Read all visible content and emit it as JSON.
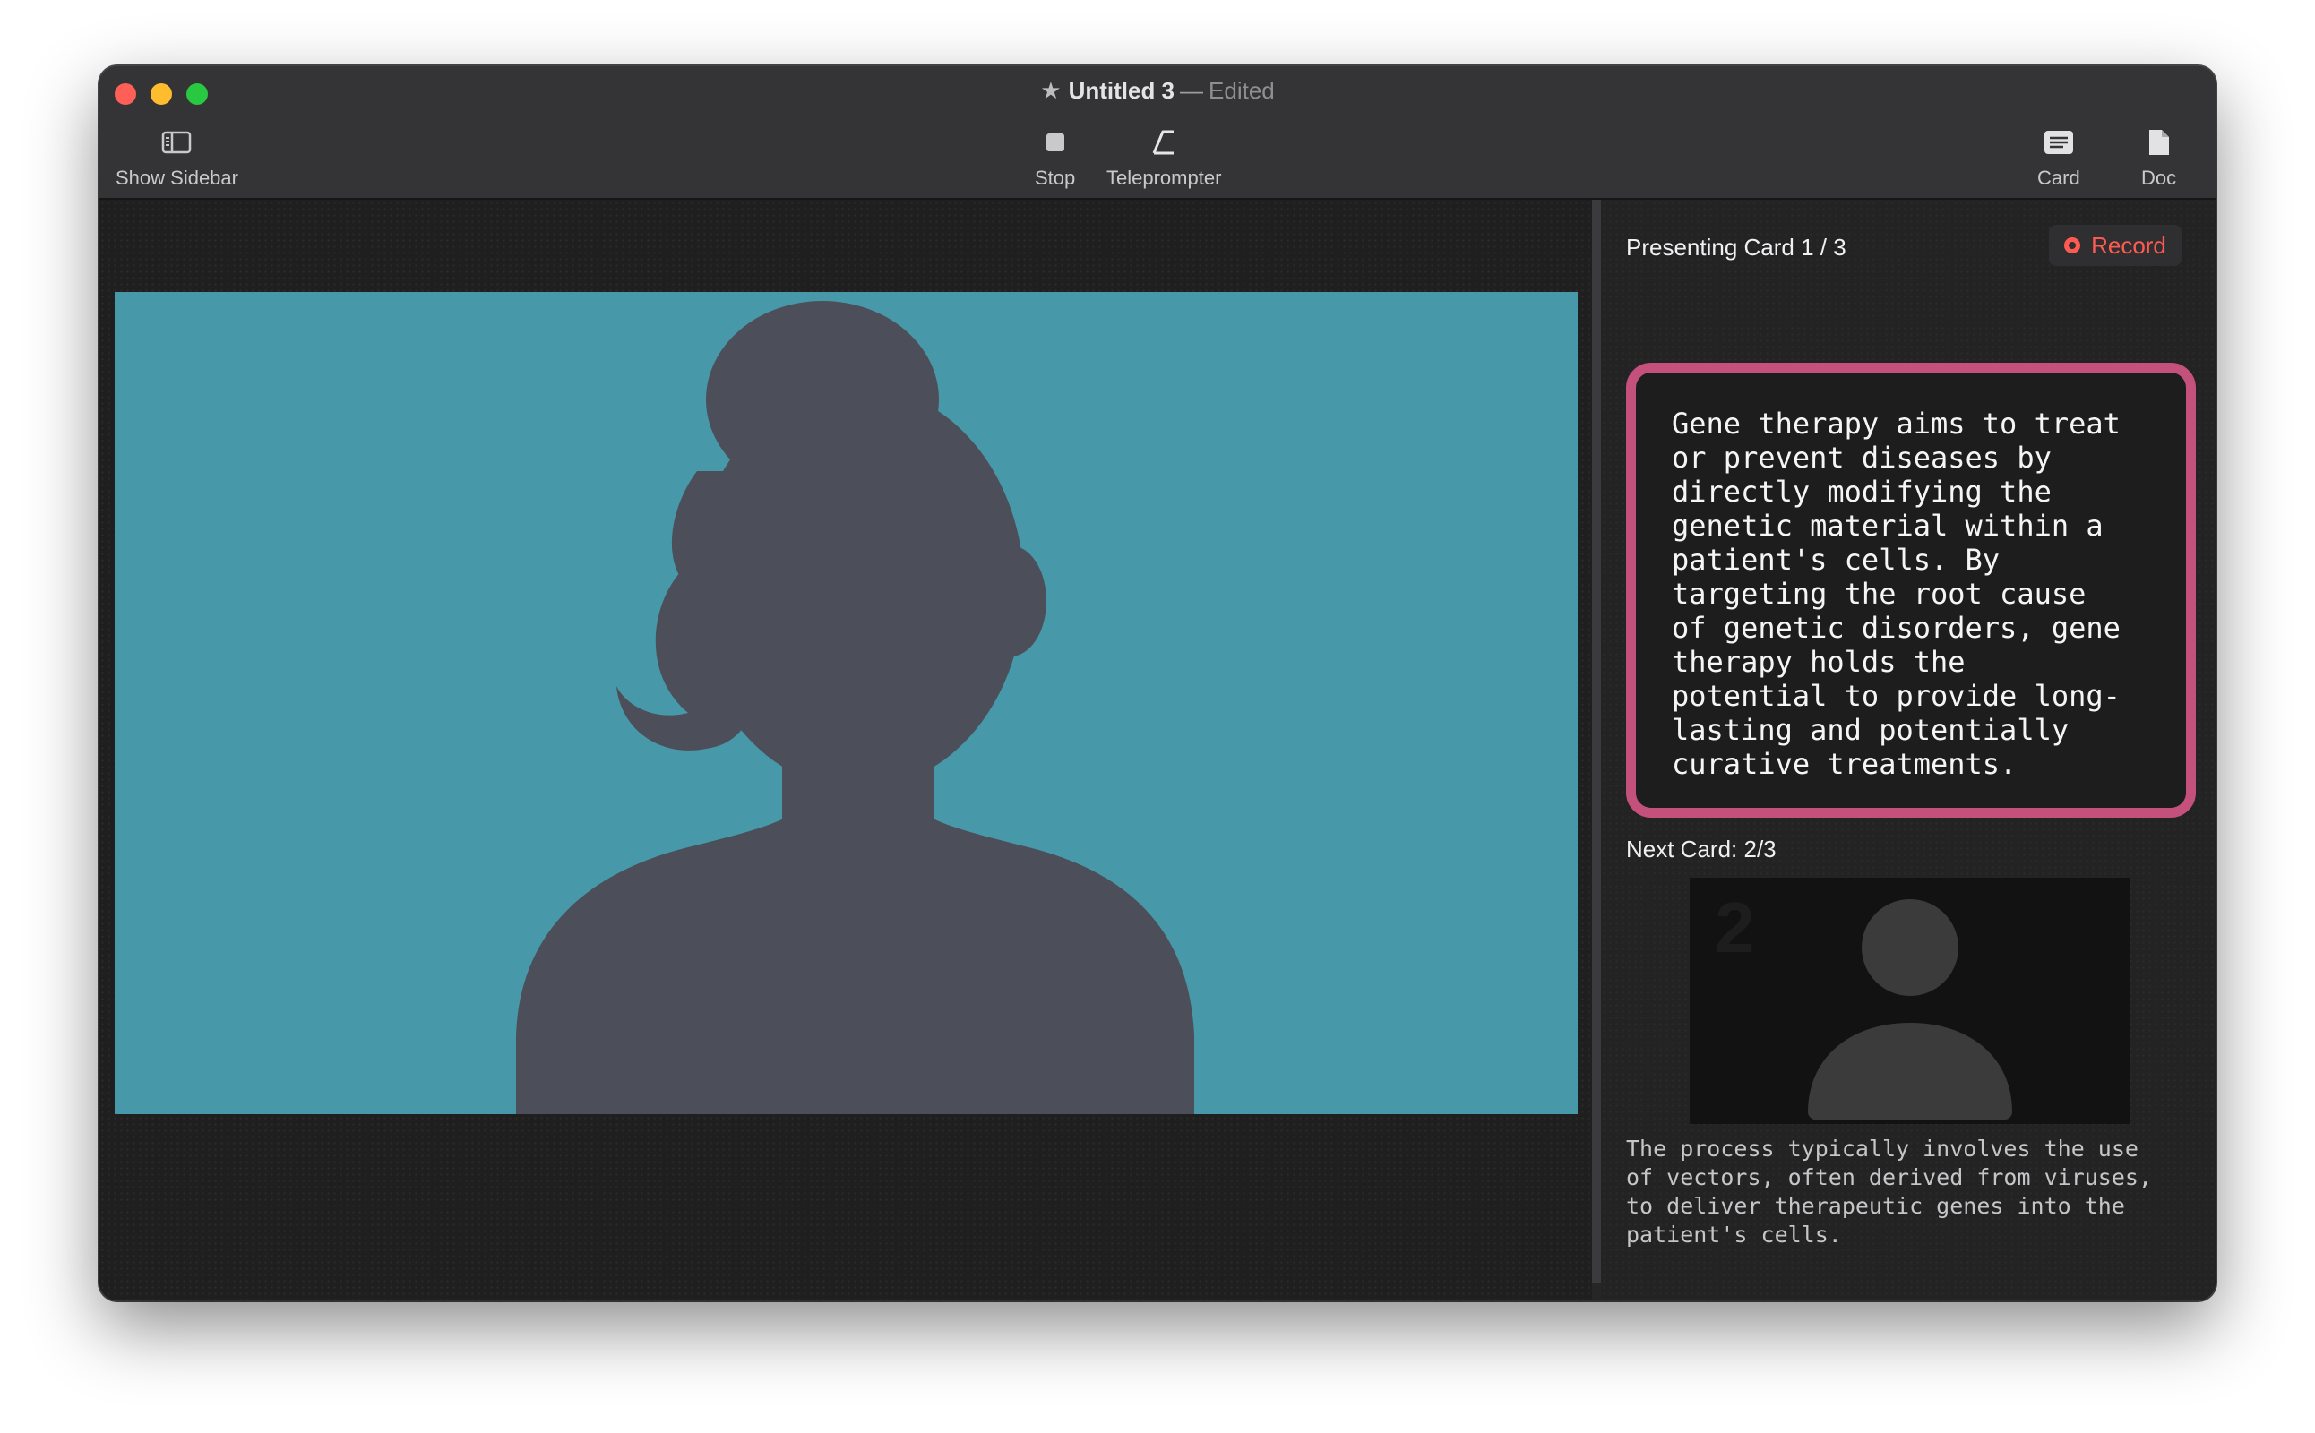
{
  "window": {
    "title": "Untitled 3",
    "title_separator": "—",
    "status": "Edited"
  },
  "toolbar": {
    "show_sidebar_label": "Show Sidebar",
    "stop_label": "Stop",
    "teleprompter_label": "Teleprompter",
    "card_label": "Card",
    "doc_label": "Doc"
  },
  "panel": {
    "presenting_label": "Presenting Card 1 / 3",
    "record_label": "Record",
    "current_script": "Gene therapy aims to treat\nor prevent diseases by\ndirectly modifying the\ngenetic material within a\npatient's cells. By\ntargeting the root cause\nof genetic disorders, gene\ntherapy holds the\npotential to provide long-\nlasting and potentially\ncurative treatments.",
    "next_label": "Next Card: 2/3",
    "next_thumb_number": "2",
    "next_script": "The process typically involves the use\nof vectors, often derived from viruses,\nto deliver therapeutic genes into the\npatient's cells."
  },
  "colors": {
    "stage_background": "#4799a9",
    "silhouette": "#4c4f5a",
    "card_border": "#c4507c",
    "record_red": "#ff5a52"
  },
  "icons": {
    "sidebar": "sidebar-icon",
    "stop": "stop-icon",
    "teleprompter": "teleprompter-icon",
    "card": "card-icon",
    "doc": "doc-icon",
    "record": "record-icon",
    "star": "star-icon"
  }
}
